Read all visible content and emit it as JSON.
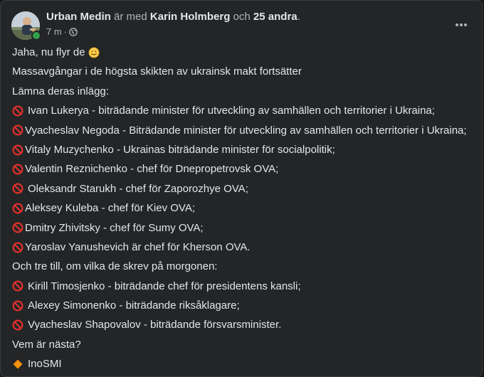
{
  "post": {
    "author": "Urban Medin",
    "with_text": "är med",
    "tagged": "Karin Holmberg",
    "and_text": "och",
    "others": "25 andra",
    "period": ".",
    "time": "7 m",
    "dot": "·",
    "privacy_icon": "globe-icon",
    "more_icon": "more-options-icon",
    "lines": [
      {
        "text": "Jaha, nu flyr de",
        "emoji": "slightly-smiling-face",
        "emoji_position": "after"
      },
      {
        "text": "Massavgångar i de högsta skikten av ukrainsk makt fortsätter"
      },
      {
        "text": "Lämna deras inlägg:"
      },
      {
        "text": "Ivan Lukerya - biträdande minister för utveckling av samhällen och territorier i Ukraina;",
        "emoji": "no-entry-sign",
        "spaced": true
      },
      {
        "text": "Vyacheslav Negoda - Biträdande minister för utveckling av samhällen och territorier i Ukraina;",
        "emoji": "no-entry-sign"
      },
      {
        "text": "Vitaly Muzychenko - Ukrainas biträdande minister för socialpolitik;",
        "emoji": "no-entry-sign"
      },
      {
        "text": "Valentin Reznichenko - chef för Dnepropetrovsk OVA;",
        "emoji": "no-entry-sign"
      },
      {
        "text": "Oleksandr Starukh - chef för Zaporozhye OVA;",
        "emoji": "no-entry-sign",
        "spaced": true
      },
      {
        "text": "Aleksey Kuleba - chef för Kiev OVA;",
        "emoji": "no-entry-sign"
      },
      {
        "text": "Dmitry Zhivitsky - chef för Sumy OVA;",
        "emoji": "no-entry-sign"
      },
      {
        "text": "Yaroslav Yanushevich är chef för Kherson OVA.",
        "emoji": "no-entry-sign"
      },
      {
        "text": "Och tre till, om vilka de skrev på morgonen:"
      },
      {
        "text": "Kirill Timosjenko - biträdande chef för presidentens kansli;",
        "emoji": "no-entry-sign",
        "spaced": true
      },
      {
        "text": "Alexey Simonenko - biträdande riksåklagare;",
        "emoji": "no-entry-sign",
        "spaced": true
      },
      {
        "text": "Vyacheslav Shapovalov - biträdande försvarsminister.",
        "emoji": "no-entry-sign",
        "spaced": true
      },
      {
        "text": "Vem är nästa?"
      },
      {
        "text": "InoSMI",
        "emoji": "orange-diamond",
        "spaced": true
      }
    ]
  },
  "colors": {
    "card_bg": "#242526",
    "primary_text": "#e4e6eb",
    "secondary_text": "#b0b3b8",
    "online": "#31a24c",
    "no_entry_red": "#e0312d",
    "orange_diamond": "#f4900c"
  }
}
